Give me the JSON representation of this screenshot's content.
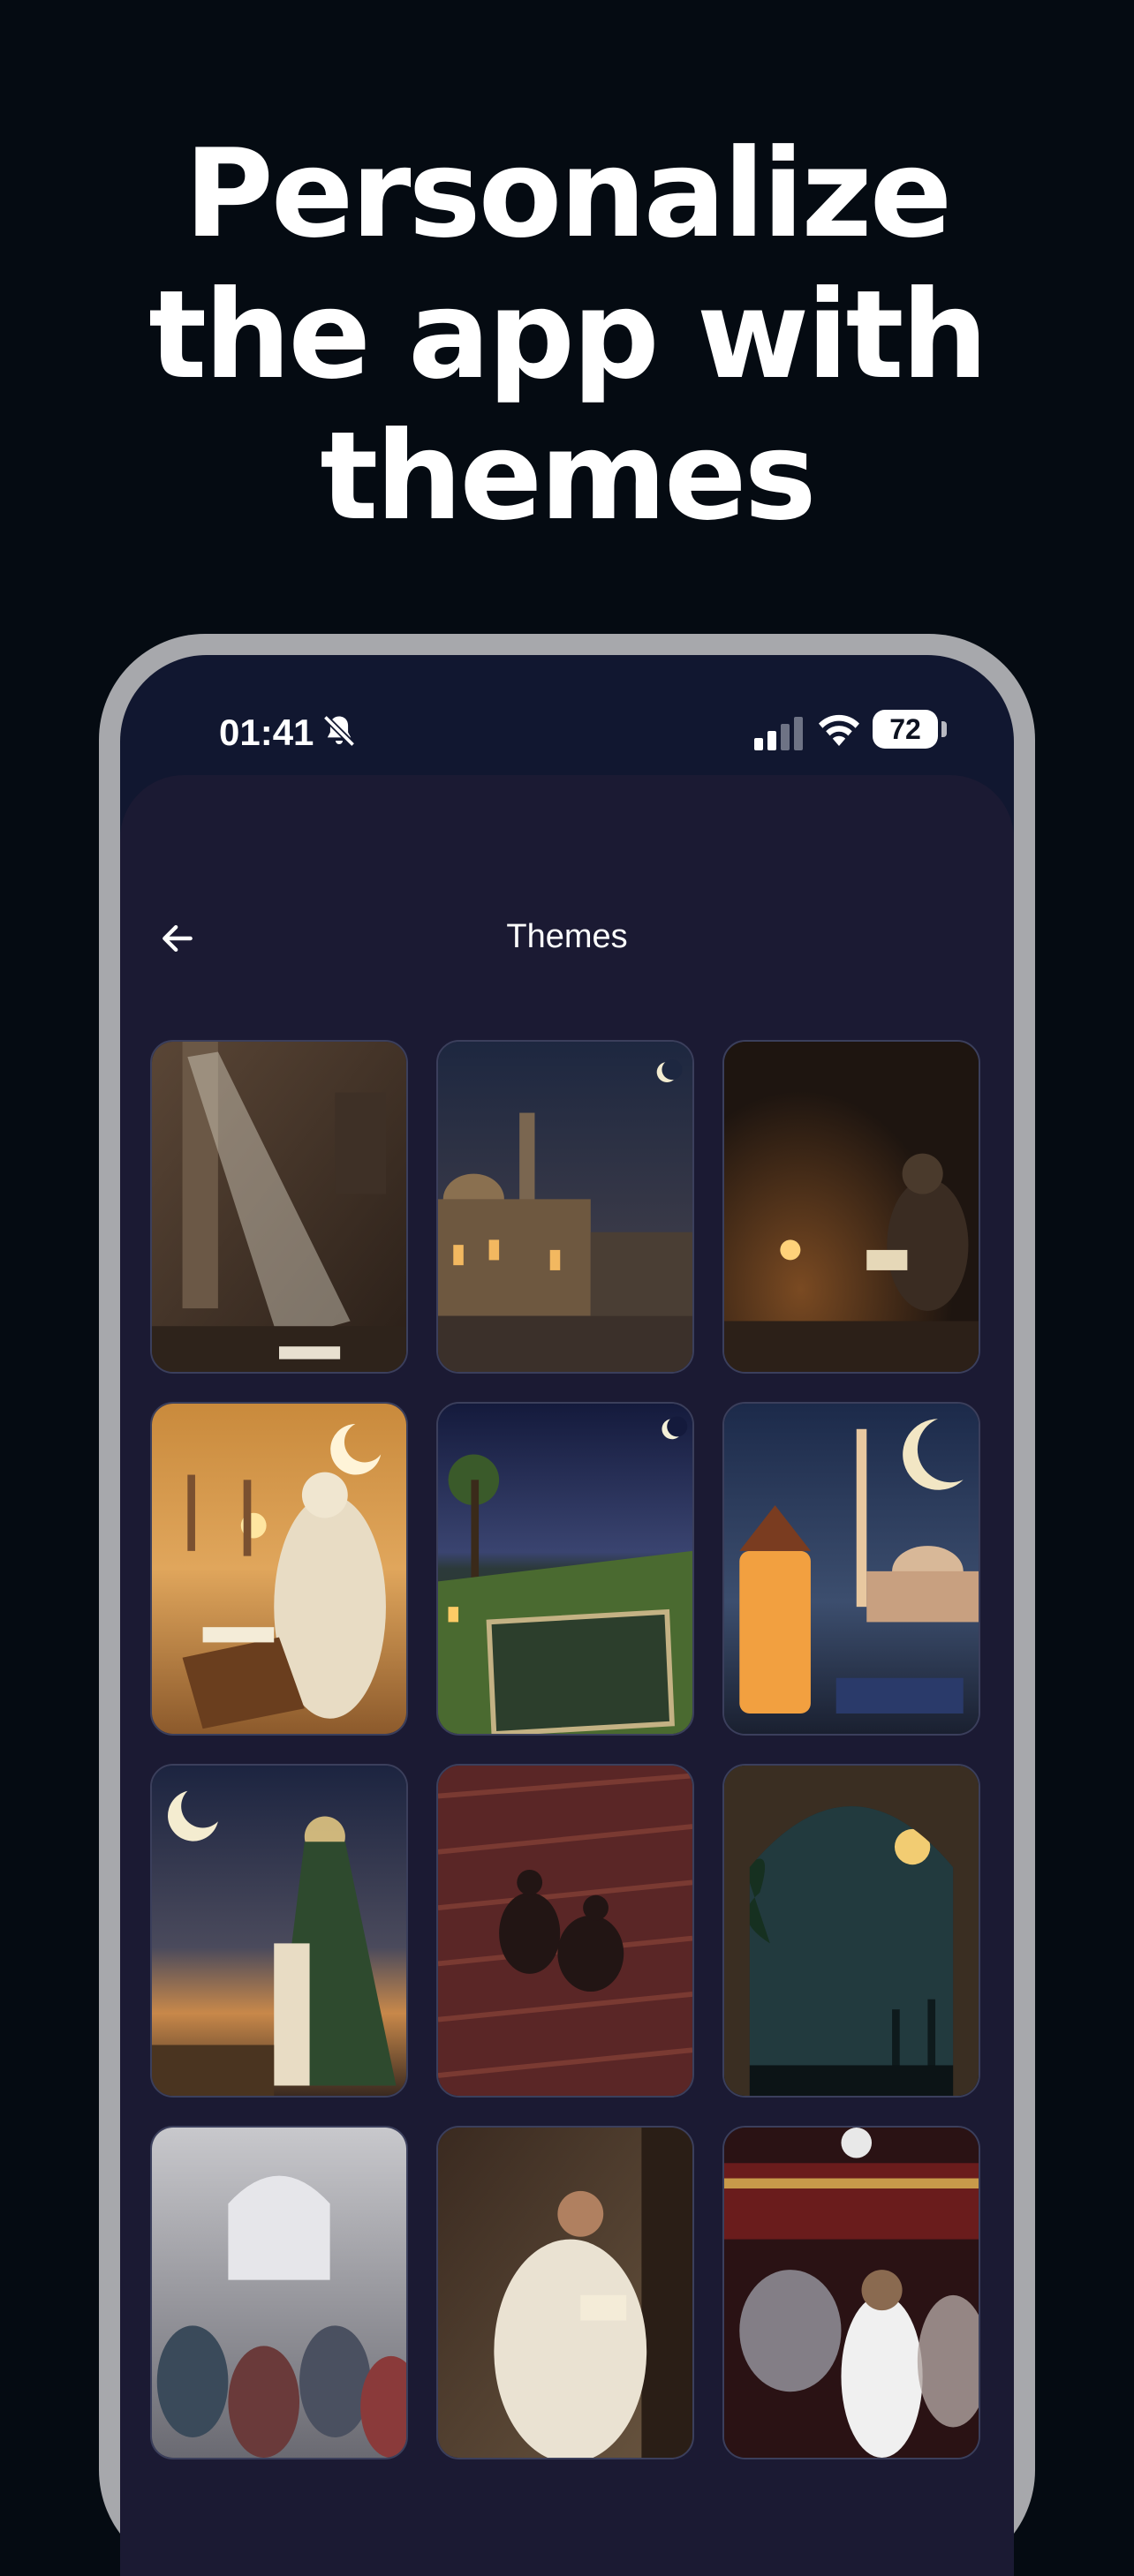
{
  "headline": {
    "line1": "Personalize",
    "line2": "the app with",
    "line3": "themes"
  },
  "status_bar": {
    "time": "01:41",
    "battery": "72",
    "icons": [
      "bell-slash-icon",
      "cellular-signal-icon",
      "wifi-icon",
      "battery-icon"
    ]
  },
  "screen": {
    "title": "Themes",
    "back_icon": "arrow-left-icon"
  },
  "colors": {
    "page_background": "#050b12",
    "phone_frame": "#a7a8ac",
    "sheet_background": "#1b1a33",
    "text": "#ffffff"
  }
}
